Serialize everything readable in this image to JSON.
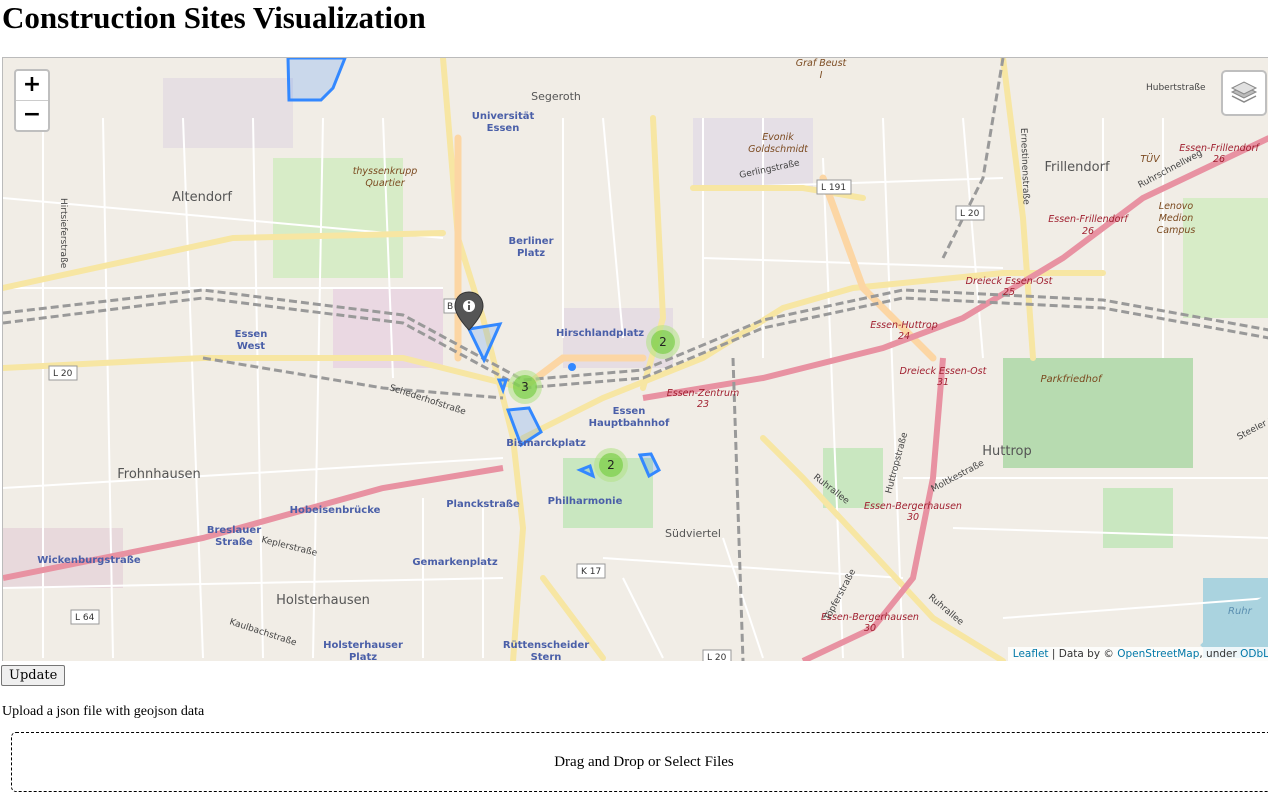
{
  "page": {
    "title": "Construction Sites Visualization"
  },
  "map": {
    "zoom_in_label": "+",
    "zoom_out_label": "−",
    "layers_control_icon": "layers-icon",
    "marker_icon": "info-marker-icon",
    "clusters": [
      {
        "count": "2"
      },
      {
        "count": "3"
      },
      {
        "count": "2"
      }
    ],
    "place_labels": {
      "segeroth": "Segeroth",
      "universitat_1": "Universität",
      "universitat_2": "Essen",
      "graf_beust_1": "Graf Beust",
      "graf_beust_2": "I",
      "evonik_1": "Evonik",
      "evonik_2": "Goldschmidt",
      "thyssen_1": "thyssenkrupp",
      "thyssen_2": "Quartier",
      "altendorf": "Altendorf",
      "berliner_1": "Berliner",
      "berliner_2": "Platz",
      "frillendorf": "Frillendorf",
      "tuv": "TÜV",
      "lenovo_1": "Lenovo",
      "lenovo_2": "Medion",
      "lenovo_3": "Campus",
      "essen_frillendorf_a": "Essen-Frillendorf",
      "essen_frillendorf_a2": "26",
      "essen_frillendorf_b": "Essen-Frillendorf",
      "essen_frillendorf_b2": "26",
      "dreieck_ost_1": "Dreieck Essen-Ost",
      "dreieck_ost_1b": "25",
      "dreieck_ost_2": "Dreieck Essen-Ost",
      "dreieck_ost_2b": "31",
      "essen_huttrop": "Essen-Huttrop",
      "essen_huttrop_2": "24",
      "essen_west_1": "Essen",
      "essen_west_2": "West",
      "hirschlandplatz": "Hirschlandplatz",
      "essen_zentrum": "Essen-Zentrum",
      "essen_zentrum_2": "23",
      "essen_hbf_1": "Essen",
      "essen_hbf_2": "Hauptbahnhof",
      "bismarckplatz": "Bismarckplatz",
      "parkfriedhof": "Parkfriedhof",
      "huttrop": "Huttrop",
      "frohnhausen": "Frohnhausen",
      "hobeisenbrucke": "Hobeisenbrücke",
      "planckstrasse": "Planckstraße",
      "philharmonie": "Philharmonie",
      "sudviertel": "Südviertel",
      "breslauer_1": "Breslauer",
      "breslauer_2": "Straße",
      "wickenburgstrasse": "Wickenburgstraße",
      "gemarkenplatz": "Gemarkenplatz",
      "holsterhausen": "Holsterhausen",
      "holsterhauser_1": "Holsterhauser",
      "holsterhauser_2": "Platz",
      "ruttenscheider_1": "Rüttenscheider",
      "ruttenscheider_2": "Stern",
      "essen_bergerhausen_a": "Essen-Bergerhausen",
      "essen_bergerhausen_a2": "30",
      "essen_bergerhausen_b": "Essen-Bergerhausen",
      "essen_bergerhausen_b2": "30",
      "ruhr": "Ruhr"
    },
    "road_labels": {
      "hubertstrasse": "Hubertstraße",
      "gerlingstrasse": "Gerlingstraße",
      "ernestinenstrasse": "Ernestinenstraße",
      "ruhrschnellweg": "Ruhrschnellweg",
      "hirtsieferstrasse": "Hirtsieferstraße",
      "schederhofstrasse": "Schederhofstraße",
      "ruhrallee_1": "Ruhrallee",
      "ruhrallee_2": "Ruhrallee",
      "huttropstrasse": "Huttropstraße",
      "moltkestrasse": "Moltkestraße",
      "steeler": "Steeler Str",
      "keplerstrasse": "Keplerstraße",
      "kaulbachstrasse": "Kaulbachstraße",
      "topferstrasse": "Töpferstraße"
    },
    "road_shields": {
      "l191": "L 191",
      "l20_top": "L 20",
      "l20_left": "L 20",
      "k17": "K 17",
      "l64": "L 64",
      "l20_bottom": "L 20",
      "b_shield": "B"
    },
    "attribution": {
      "leaflet": "Leaflet",
      "separator": " | Data by © ",
      "osm": "OpenStreetMap",
      "under": ", under ",
      "odbl": "ODbL"
    }
  },
  "controls": {
    "update_label": "Update",
    "upload_label": "Upload a json file with geojson data",
    "dropzone_label": "Drag and Drop or Select Files"
  }
}
